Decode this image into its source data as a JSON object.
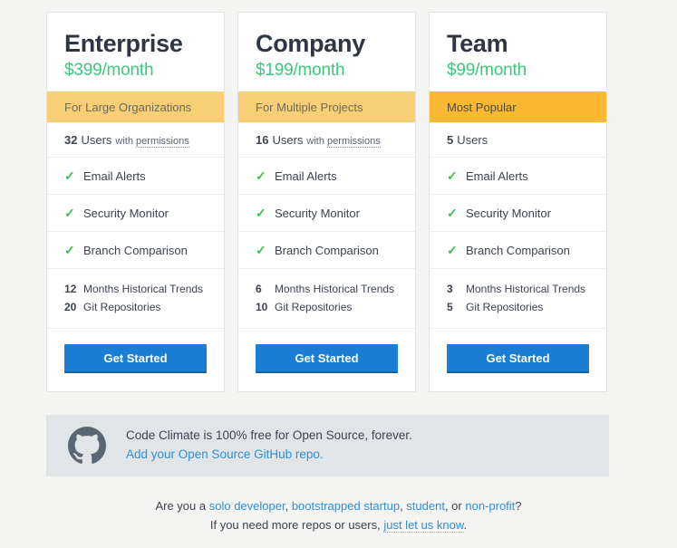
{
  "plans": [
    {
      "name": "Enterprise",
      "price": "$399/month",
      "ribbon": "For Large Organizations",
      "ribbon_style": "light",
      "users_count": "32",
      "users_label": "Users",
      "users_suffix_pre": "with",
      "users_suffix_tooltip": "permissions",
      "features": [
        "Email Alerts",
        "Security Monitor",
        "Branch Comparison"
      ],
      "months_num": "12",
      "months_label": "Months Historical Trends",
      "repos_num": "20",
      "repos_label": "Git Repositories",
      "cta": "Get Started"
    },
    {
      "name": "Company",
      "price": "$199/month",
      "ribbon": "For Multiple Projects",
      "ribbon_style": "light",
      "users_count": "16",
      "users_label": "Users",
      "users_suffix_pre": "with",
      "users_suffix_tooltip": "permissions",
      "features": [
        "Email Alerts",
        "Security Monitor",
        "Branch Comparison"
      ],
      "months_num": "6",
      "months_label": "Months Historical Trends",
      "repos_num": "10",
      "repos_label": "Git Repositories",
      "cta": "Get Started"
    },
    {
      "name": "Team",
      "price": "$99/month",
      "ribbon": "Most Popular",
      "ribbon_style": "bold",
      "users_count": "5",
      "users_label": "Users",
      "users_suffix_pre": "",
      "users_suffix_tooltip": "",
      "features": [
        "Email Alerts",
        "Security Monitor",
        "Branch Comparison"
      ],
      "months_num": "3",
      "months_label": "Months Historical Trends",
      "repos_num": "5",
      "repos_label": "Git Repositories",
      "cta": "Get Started"
    }
  ],
  "open_source_banner": {
    "icon": "github-icon",
    "line1": "Code Climate is 100% free for Open Source, forever.",
    "link": "Add your Open Source GitHub repo."
  },
  "footer": {
    "line1_prefix": "Are you a ",
    "link_solo": "solo developer",
    "sep1": ", ",
    "link_bootstrapped": "bootstrapped startup",
    "sep2": ", ",
    "link_student": "student",
    "sep3": ", or ",
    "link_nonprofit": "non-profit",
    "line1_suffix": "?",
    "line2_prefix": "If you need more repos or users, ",
    "link_letusknow": "just let us know",
    "line2_suffix": "."
  },
  "colors": {
    "page_bg": "#f4f4f2",
    "card_bg": "#ffffff",
    "card_border": "#e3e3e1",
    "ribbon_light": "#f7cf74",
    "ribbon_bold": "#f8b832",
    "price_green": "#3ec87c",
    "check_green": "#3dbe4e",
    "cta_blue": "#1a7fd4",
    "link_blue": "#2e8fd6",
    "banner_bg": "#e1e5e8",
    "heading": "#2f3545",
    "github_mark": "#5a6772"
  },
  "icons": {
    "check": "✓"
  }
}
